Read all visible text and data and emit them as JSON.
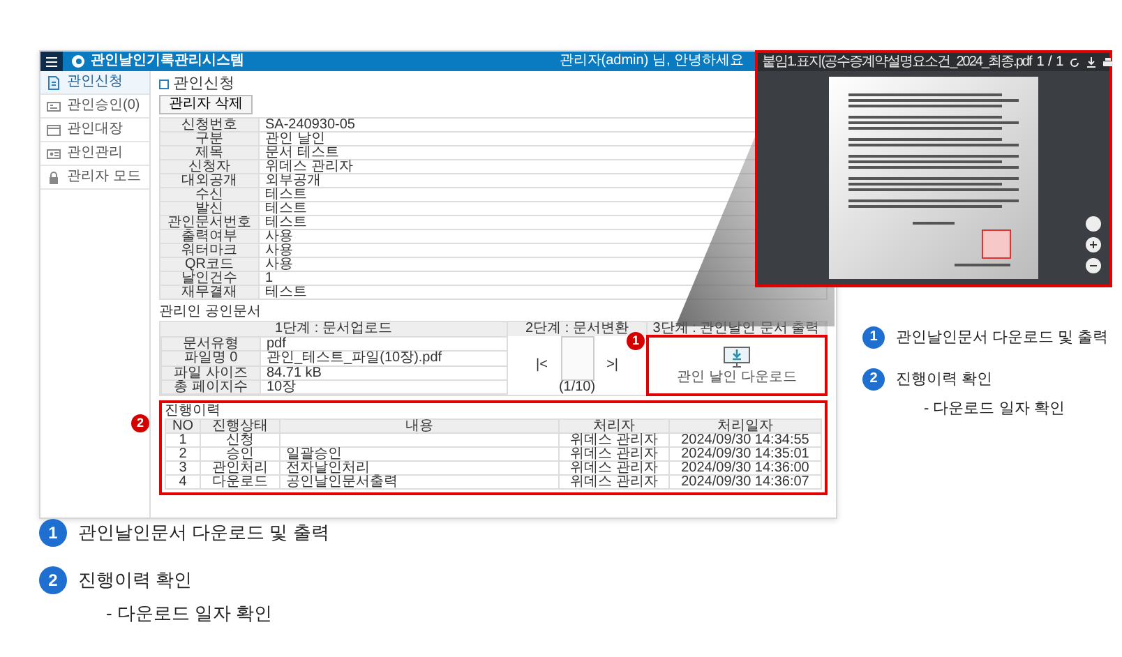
{
  "header": {
    "title": "관인날인기록관리시스템",
    "user_greeting": "관리자(admin) 님, 안녕하세요"
  },
  "sidebar": {
    "items": [
      {
        "label": "관인신청",
        "selected": true
      },
      {
        "label": "관인승인(0)",
        "selected": false
      },
      {
        "label": "관인대장",
        "selected": false
      },
      {
        "label": "관인관리",
        "selected": false
      },
      {
        "label": "관리자 모드",
        "selected": false
      }
    ]
  },
  "page_title": "관인신청",
  "toolbar_button": "관리자 삭제",
  "info_table": {
    "rows": [
      {
        "label": "신청번호",
        "value": "SA-240930-05"
      },
      {
        "label": "구분",
        "value": "관인 날인"
      },
      {
        "label": "제목",
        "value": "문서 테스트"
      },
      {
        "label": "신청자",
        "value": "위데스 관리자"
      },
      {
        "label": "대외공개",
        "value": "외부공개"
      },
      {
        "label": "수신",
        "value": "테스트"
      },
      {
        "label": "발신",
        "value": "테스트"
      },
      {
        "label": "관인문서번호",
        "value": "테스트"
      },
      {
        "label": "출력여부",
        "value": "사용"
      },
      {
        "label": "워터마크",
        "value": "사용"
      },
      {
        "label": "QR코드",
        "value": "사용"
      },
      {
        "label": "날인건수",
        "value": "1"
      },
      {
        "label": "재무결재",
        "value": "테스트"
      }
    ]
  },
  "document_section": {
    "title": "관리인 공인문서",
    "upload": {
      "header": "1단계 : 문서업로드",
      "rows": [
        {
          "label": "문서유형",
          "value": "pdf"
        },
        {
          "label": "파일명 0",
          "value": "관인_테스트_파일(10장).pdf"
        },
        {
          "label": "파일 사이즈",
          "value": "84.71 kB"
        },
        {
          "label": "총 페이지수",
          "value": "10장"
        }
      ]
    },
    "convert": {
      "header": "2단계 : 문서변환",
      "first": "|<",
      "last": ">|",
      "page": "(1/10)"
    },
    "output": {
      "header": "3단계 : 관인날인 문서 출력",
      "button": "관인 날인 다운로드"
    }
  },
  "history": {
    "title": "진행이력",
    "columns": [
      "NO",
      "진행상태",
      "내용",
      "처리자",
      "처리일자"
    ],
    "rows": [
      {
        "no": "1",
        "status": "신청",
        "handler": "위데스 관리자",
        "date": "2024/09/30 14:34:55"
      },
      {
        "no": "2",
        "status": "승인",
        "content": "일괄승인",
        "handler": "위데스 관리자",
        "date": "2024/09/30 14:35:01"
      },
      {
        "no": "3",
        "status": "관인처리",
        "content": "전자날인처리",
        "handler": "위데스 관리자",
        "date": "2024/09/30 14:36:00"
      },
      {
        "no": "4",
        "status": "다운로드",
        "content": "공인날인문서출력",
        "handler": "위데스 관리자",
        "date": "2024/09/30 14:36:07"
      }
    ]
  },
  "callouts": [
    {
      "number": "1"
    },
    {
      "number": "2"
    }
  ],
  "viewer": {
    "filename": "붙임1.표지(공수증계약설명요소건_2024_최종.pdf",
    "page": "1 / 1"
  },
  "legend_right": [
    {
      "number": "1",
      "lines": [
        "관인날인문서 다운로드 및 출력"
      ]
    },
    {
      "number": "2",
      "lines": [
        "진행이력 확인",
        "- 다운로드 일자 확인"
      ]
    }
  ],
  "legend_bottom": [
    {
      "number": "1",
      "lines": [
        "관인날인문서 다운로드 및 출력"
      ]
    },
    {
      "number": "2",
      "lines": [
        "진행이력 확인",
        "- 다운로드 일자 확인"
      ]
    }
  ]
}
